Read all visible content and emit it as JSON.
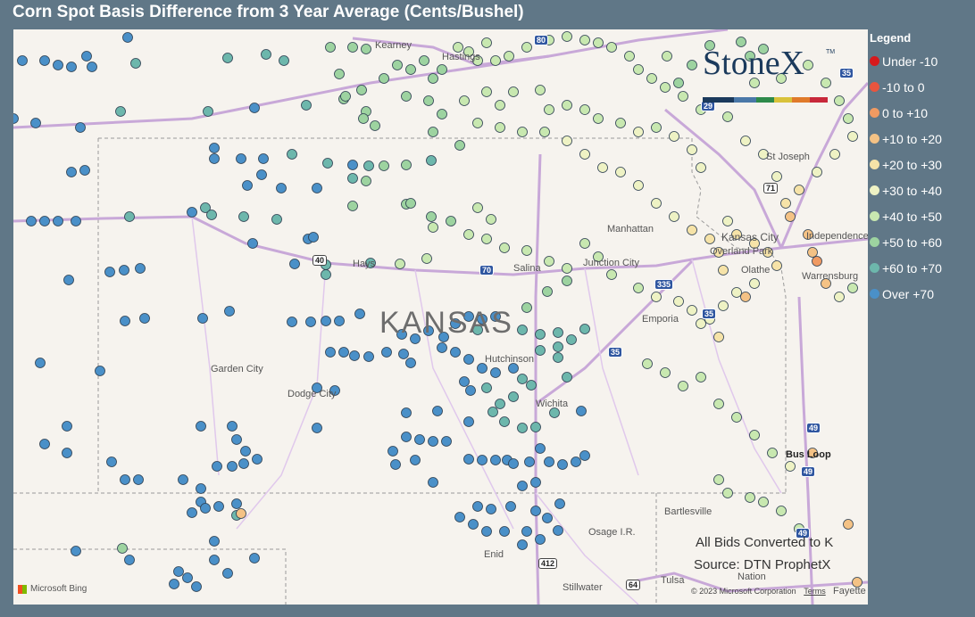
{
  "title": "Corn Spot Basis Difference from 3 Year Average (Cents/Bushel)",
  "legend": {
    "title": "Legend",
    "items": [
      {
        "label": "Under -10",
        "color": "#d7191c"
      },
      {
        "label": "-10 to 0",
        "color": "#e8553e"
      },
      {
        "label": "0 to +10",
        "color": "#f09a62"
      },
      {
        "label": "+10 to +20",
        "color": "#f4c285"
      },
      {
        "label": "+20 to +30",
        "color": "#f6e3a8"
      },
      {
        "label": "+30 to +40",
        "color": "#eef2c4"
      },
      {
        "label": "+40 to +50",
        "color": "#c8e8b0"
      },
      {
        "label": "+50 to +60",
        "color": "#9dd3a0"
      },
      {
        "label": "+60 to +70",
        "color": "#6db7ac"
      },
      {
        "label": "Over +70",
        "color": "#4a90c8"
      }
    ]
  },
  "logo": {
    "text": "StoneX",
    "tm": "TM"
  },
  "notes": {
    "converted": "All Bids Converted to K",
    "source": "Source: DTN ProphetX"
  },
  "attribution": {
    "bing": "Microsoft Bing",
    "copyright": "© 2023 Microsoft Corporation",
    "terms": "Terms"
  },
  "map": {
    "state": "KANSAS",
    "cities": [
      {
        "name": "Kearney"
      },
      {
        "name": "Hastings"
      },
      {
        "name": "St Joseph"
      },
      {
        "name": "Manhattan"
      },
      {
        "name": "Kansas City"
      },
      {
        "name": "Independence"
      },
      {
        "name": "Overland Park"
      },
      {
        "name": "Olathe"
      },
      {
        "name": "Junction City"
      },
      {
        "name": "Hays"
      },
      {
        "name": "Salina"
      },
      {
        "name": "Warrensburg"
      },
      {
        "name": "Emporia"
      },
      {
        "name": "Hutchinson"
      },
      {
        "name": "Garden City"
      },
      {
        "name": "Dodge City"
      },
      {
        "name": "Wichita"
      },
      {
        "name": "Bus Loop"
      },
      {
        "name": "Bartlesville"
      },
      {
        "name": "Osage I.R."
      },
      {
        "name": "Enid"
      },
      {
        "name": "Stillwater"
      },
      {
        "name": "Tulsa"
      },
      {
        "name": "Nation"
      },
      {
        "name": "Fayette"
      }
    ],
    "shields": [
      "80",
      "29",
      "35",
      "71",
      "40",
      "70",
      "335",
      "35",
      "35",
      "49",
      "49",
      "49",
      "412",
      "64"
    ]
  }
}
